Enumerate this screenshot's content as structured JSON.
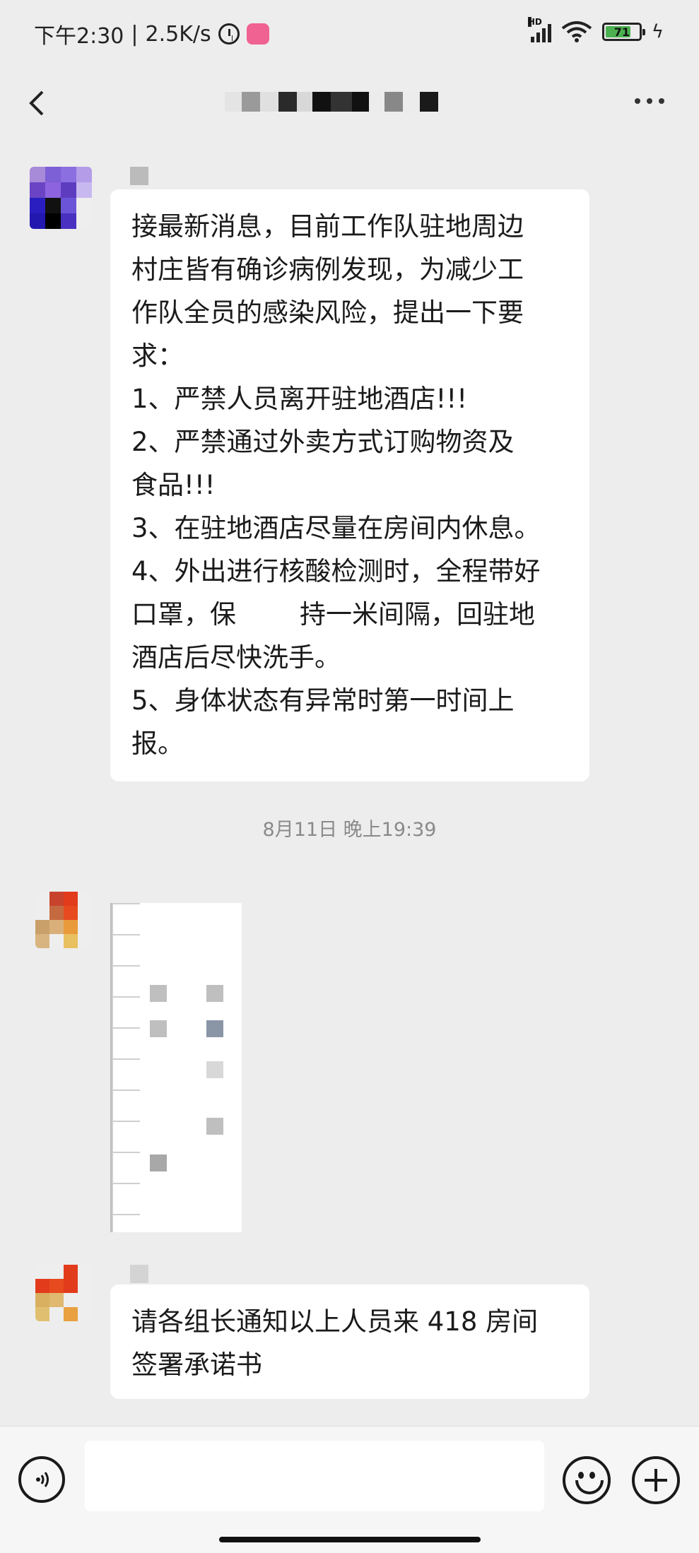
{
  "status_bar": {
    "time": "下午2:30",
    "network_speed": "2.5K/s",
    "signal_label": "HD",
    "battery_level": "71",
    "icons": [
      "alarm-icon",
      "app-icon",
      "signal-icon",
      "wifi-icon",
      "battery-icon",
      "charging-icon"
    ]
  },
  "header": {
    "back_icon": "chevron-left-icon",
    "more_icon": "more-icon"
  },
  "messages": {
    "m1": {
      "lines": [
        "接最新消息，目前工作队驻地周边",
        "村庄皆有确诊病例发现，为减少工",
        "作队全员的感染风险，提出一下要",
        "求：",
        "1、严禁人员离开驻地酒店!!!",
        "2、严禁通过外卖方式订购物资及",
        "食品!!!",
        "3、在驻地酒店尽量在房间内休息。",
        "4、外出进行核酸检测时，全程带好",
        "口罩，保",
        "持一米间隔，回驻地",
        "酒店后尽快洗手。",
        "5、身体状态有异常时第一时间上",
        "报。"
      ]
    },
    "timestamp": "8月11日 晚上19:39",
    "m3": {
      "lines": [
        "请各组长通知以上人员来 418 房间",
        "签署承诺书"
      ]
    }
  },
  "input_bar": {
    "voice_icon": "voice-icon",
    "emoji_icon": "emoji-icon",
    "plus_icon": "plus-icon"
  },
  "colors": {
    "background": "#ededed",
    "bubble": "#ffffff",
    "timestamp": "#8a8a8a"
  }
}
